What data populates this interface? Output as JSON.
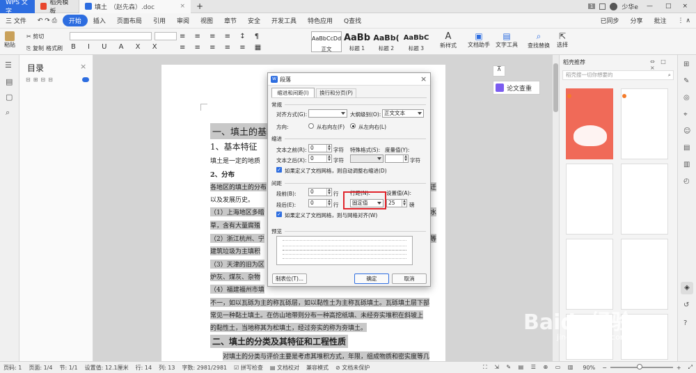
{
  "tabs": {
    "wps": "WPS 文字",
    "template": "稻壳模板",
    "doc_name": "填土",
    "doc_author": "（赵先森）.doc",
    "new_tab": "+",
    "badge": "1",
    "user": "少华e"
  },
  "menu": {
    "items": [
      "三 文件",
      "开始",
      "插入",
      "页面布局",
      "引用",
      "审阅",
      "视图",
      "章节",
      "安全",
      "开发工具",
      "特色应用"
    ],
    "search": "Q查找",
    "sync": "已同步",
    "share": "分享",
    "batch": "批注"
  },
  "ribbon": {
    "cut": "剪切",
    "paste": "粘贴",
    "copy": "复制",
    "format_painter": "格式刷",
    "styles": [
      {
        "preview": "AaBbCcDd",
        "name": "正文"
      },
      {
        "preview": "AaBb",
        "name": "标题 1"
      },
      {
        "preview": "AaBb(",
        "name": "标题 2"
      },
      {
        "preview": "AaBbC",
        "name": "标题 3"
      }
    ],
    "new_style": "新样式",
    "doc_helper": "文档助手",
    "text_tools": "文字工具",
    "find_replace": "查找替换",
    "select": "选择"
  },
  "nav": {
    "title": "目录",
    "close": "×"
  },
  "doc": {
    "h1": "一、填土的基本",
    "h2": "1、基本特征",
    "p1": "填土是一定的地质",
    "h3": "2、分布",
    "p2a": "各地区的填土的分布",
    "p2b": "以及发展历史。",
    "p2c": "迁",
    "l1a": "（1）上海地区多暗",
    "l1b": "水",
    "l1c": "草，含有大量腐殖",
    "l2a": "（2）浙江杭州、宁",
    "l2b": "等",
    "l2c": "建筑垃圾为主填积",
    "l3a": "（3）天津的旧为区",
    "l3b": "炉灰、煤灰、杂物",
    "l4": "（4）福建福州市填",
    "p4a": "不一，如以瓦砾为主的称瓦砾层，如以黏性土为主称瓦砾填土。瓦砾填土层下部",
    "p4b": "常见一种黏土填土。在仿山地带则分布一种高挖纸填、未经夯实堆积在斜坡上",
    "p4c": "的黏性土，当地称其为松填土，经过夯实的称为夯填土。",
    "h4": "二、填土的分类及其特征和工程性质",
    "p5": "对填土的分类与评价主要是考虑其堆积方式，年限，组成物质和密实度等几"
  },
  "essay_check": "论文查重",
  "right_panel": {
    "title": "稻壳推荐",
    "search_placeholder": "稻壳搜一切你想要的"
  },
  "dialog": {
    "title": "段落",
    "close": "×",
    "tab1": "缩进和间距(I)",
    "tab2": "换行和分页(P)",
    "sec_general": "常规",
    "align_label": "对齐方式(G):",
    "align_value": "",
    "outline_label": "大纲级别(O):",
    "outline_value": "正文文本",
    "direction_label": "方向:",
    "rtl": "从右向左(F)",
    "ltr": "从左向右(L)",
    "sec_indent": "缩进",
    "before_text_label": "文本之前(R):",
    "before_text_value": "0",
    "unit_char": "字符",
    "special_label": "特殊格式(S):",
    "measure_label": "度量值(Y):",
    "after_text_label": "文本之后(X):",
    "after_text_value": "0",
    "grid_indent": "如果定义了文档网格，则自动调整右缩进(D)",
    "sec_spacing": "间距",
    "before_para_label": "段前(B):",
    "before_para_value": "0",
    "unit_line": "行",
    "line_spacing_label": "行距(N):",
    "line_spacing_value": "固定值",
    "setting_label": "设置值(A):",
    "setting_value": "25",
    "unit_pt": "磅",
    "after_para_label": "段后(E):",
    "after_para_value": "0",
    "grid_snap": "如果定义了文档网格，则与网格对齐(W)",
    "sec_preview": "预览",
    "tabs_btn": "制表位(T)...",
    "ok": "确定",
    "cancel": "取消"
  },
  "status": {
    "page_no": "页码: 1",
    "pages": "页面: 1/4",
    "section": "节: 1/1",
    "setting": "设置值: 12.1厘米",
    "row": "行: 14",
    "col": "列: 13",
    "words": "字数: 2981/2981",
    "spell": "拼写检查",
    "proof": "文档校对",
    "compat": "兼容模式",
    "protect": "文档未保护",
    "zoom": "90%"
  },
  "watermark": "Baidu经验",
  "watermark_url": "jingyan.baidu.com",
  "colors": {
    "accent": "#2d6de0",
    "highlight_red": "#e0242b",
    "selection": "#c8c8c8"
  }
}
